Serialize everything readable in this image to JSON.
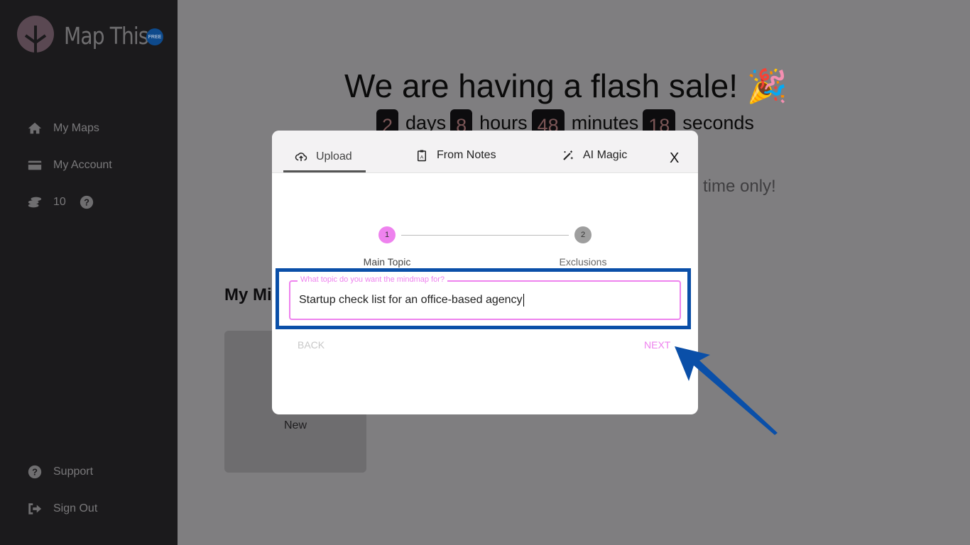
{
  "sidebar": {
    "brand": "Map This",
    "badge": "FREE",
    "items": [
      {
        "label": "My Maps",
        "icon": "home-icon"
      },
      {
        "label": "My Account",
        "icon": "credit-card-icon"
      },
      {
        "label": "10",
        "icon": "coins-icon"
      }
    ],
    "bottom": [
      {
        "label": "Support",
        "icon": "question-circle-icon"
      },
      {
        "label": "Sign Out",
        "icon": "sign-out-icon"
      }
    ]
  },
  "banner": {
    "title": "We are having a flash sale! 🎉",
    "days": "2",
    "days_label": "days",
    "hours": "8",
    "hours_label": "hours",
    "minutes": "48",
    "minutes_label": "minutes",
    "seconds": "18",
    "seconds_label": "seconds",
    "subtitle": "time only!"
  },
  "main": {
    "heading": "My Mi",
    "new_card": "New"
  },
  "modal": {
    "tabs": [
      {
        "label": "Upload",
        "icon": "cloud-upload-icon"
      },
      {
        "label": "From Notes",
        "icon": "clipboard-icon"
      },
      {
        "label": "AI Magic",
        "icon": "magic-wand-icon"
      }
    ],
    "close": "X",
    "steps": [
      {
        "num": "1",
        "label": "Main Topic"
      },
      {
        "num": "2",
        "label": "Exclusions"
      }
    ],
    "field_label": "What topic do you want the mindmap for?",
    "field_value": "Startup check list for an office-based agency",
    "back": "BACK",
    "next": "NEXT"
  },
  "colors": {
    "accent": "#ee82ee",
    "highlight": "#0a4fa8"
  }
}
